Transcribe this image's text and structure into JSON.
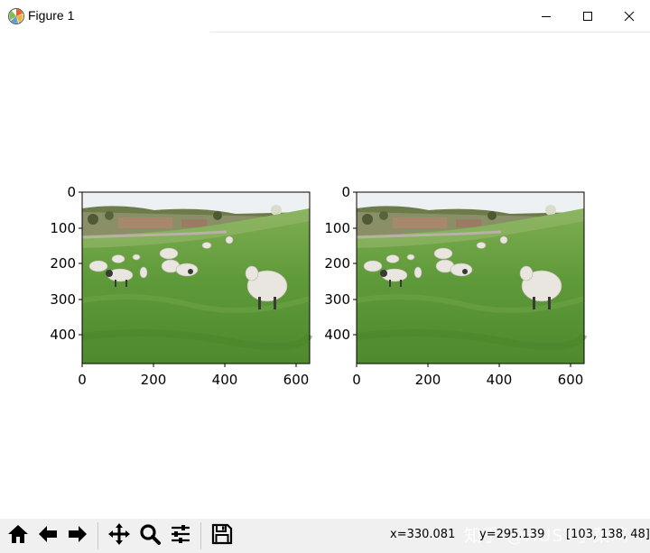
{
  "window": {
    "title": "Figure 1",
    "app_icon": "matplotlib-icon",
    "controls": [
      "minimize-icon",
      "maximize-icon",
      "close-icon"
    ]
  },
  "figure": {
    "axes": [
      {
        "image": "sheep-grazing-on-green-hillside",
        "xticks": [
          "0",
          "200",
          "400",
          "600"
        ],
        "yticks": [
          "0",
          "100",
          "200",
          "300",
          "400"
        ]
      },
      {
        "image": "sheep-grazing-on-green-hillside",
        "xticks": [
          "0",
          "200",
          "400",
          "600"
        ],
        "yticks": [
          "0",
          "100",
          "200",
          "300",
          "400"
        ]
      }
    ]
  },
  "toolbar": {
    "buttons": [
      {
        "icon": "home-icon"
      },
      {
        "icon": "back-arrow-icon"
      },
      {
        "icon": "forward-arrow-icon"
      },
      {
        "icon": "pan-icon"
      },
      {
        "icon": "zoom-icon"
      },
      {
        "icon": "configure-subplots-icon"
      },
      {
        "icon": "save-icon"
      }
    ],
    "x_readout": "x=330.081",
    "y_readout": "y=295.139",
    "pixel_value": "[103, 138, 48]",
    "watermark": "知乎 @HUST小菜鸡"
  },
  "colors": {
    "sky": "#eef1f3",
    "grass": "#5f9a3a",
    "sheep": "#e8e6df",
    "toolbar_bg": "#f0f0f0"
  }
}
